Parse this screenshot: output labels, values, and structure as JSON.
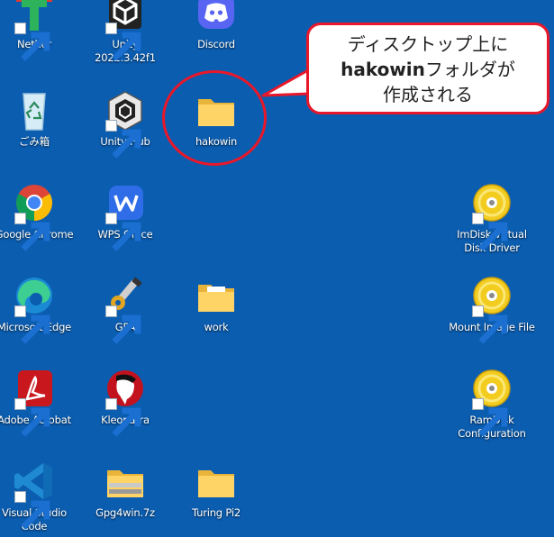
{
  "desktop_icons": [
    {
      "id": "nethor",
      "label": "Nethor",
      "icon": "nethor-icon"
    },
    {
      "id": "unity",
      "label": "Unity 2022.3.42f1",
      "icon": "unity-icon"
    },
    {
      "id": "discord",
      "label": "Discord",
      "icon": "discord-icon"
    },
    {
      "id": "recycle-bin",
      "label": "ごみ箱",
      "icon": "recycle-bin-icon"
    },
    {
      "id": "unity-hub",
      "label": "Unity Hub",
      "icon": "unity-hub-icon"
    },
    {
      "id": "hakowin",
      "label": "hakowin",
      "icon": "folder-icon"
    },
    {
      "id": "chrome",
      "label": "Google Chrome",
      "icon": "chrome-icon"
    },
    {
      "id": "wps",
      "label": "WPS Office",
      "icon": "wps-office-icon"
    },
    {
      "id": "imdisk",
      "label": "ImDisk Virtual Disk Driver",
      "icon": "disc-icon"
    },
    {
      "id": "edge",
      "label": "Microsoft Edge",
      "icon": "edge-icon"
    },
    {
      "id": "gpa",
      "label": "GPA",
      "icon": "gpa-icon"
    },
    {
      "id": "work",
      "label": "work",
      "icon": "folder-icon"
    },
    {
      "id": "mount-image",
      "label": "Mount Image File",
      "icon": "disc-icon"
    },
    {
      "id": "acrobat",
      "label": "Adobe Acrobat",
      "icon": "acrobat-icon"
    },
    {
      "id": "kleopatra",
      "label": "Kleopatra",
      "icon": "kleopatra-icon"
    },
    {
      "id": "ramdisk",
      "label": "RamDisk Configuration",
      "icon": "disc-icon"
    },
    {
      "id": "vscode",
      "label": "Visual Studio Code",
      "icon": "vscode-icon"
    },
    {
      "id": "gpg4win",
      "label": "Gpg4win.7z",
      "icon": "archive-folder-icon"
    },
    {
      "id": "turing",
      "label": "Turing Pi2",
      "icon": "folder-icon"
    }
  ],
  "callout": {
    "line1": "ディスクトップ上に",
    "line2_bold": "hakowin",
    "line2_rest": "フォルダが",
    "line3": "作成される"
  },
  "colors": {
    "desktop_bg": "#0b5db0",
    "highlight": "#e8182a"
  }
}
